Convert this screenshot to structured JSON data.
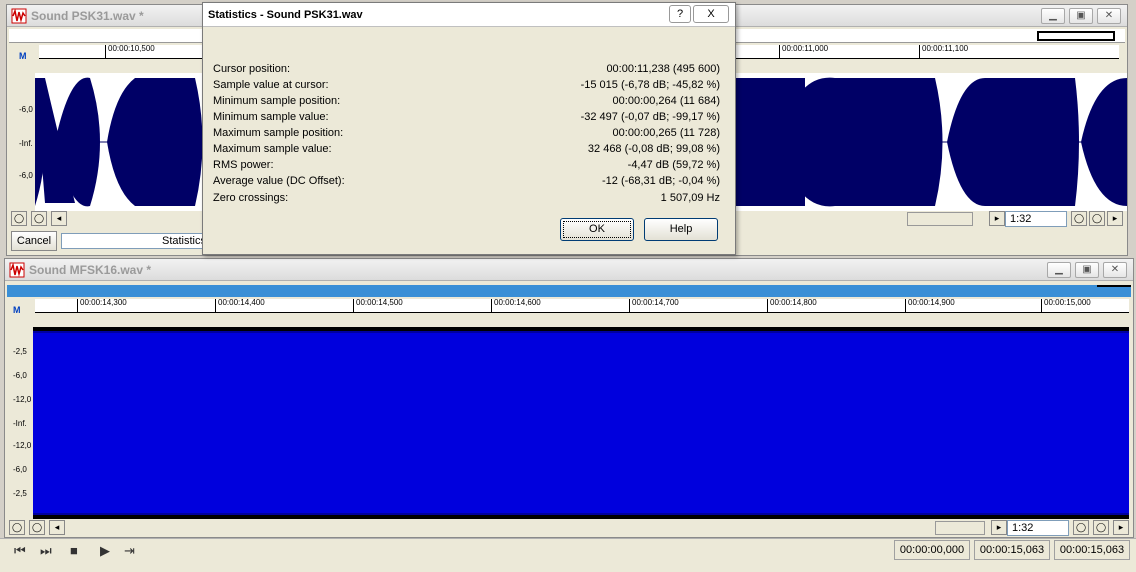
{
  "window1": {
    "title": "Sound PSK31.wav *",
    "ruler_ticks": [
      "00:00:10,500",
      "00:00:11,000",
      "00:00:11,100"
    ],
    "y_labels": [
      "-6,0",
      "-Inf.",
      "-6,0"
    ],
    "zoom_value": "1:32",
    "cancel_label": "Cancel",
    "status_text": "Statistics"
  },
  "window2": {
    "title": "Sound MFSK16.wav *",
    "ruler_ticks": [
      "00:00:14,300",
      "00:00:14,400",
      "00:00:14,500",
      "00:00:14,600",
      "00:00:14,700",
      "00:00:14,800",
      "00:00:14,900",
      "00:00:15,000"
    ],
    "y_labels": [
      "-2,5",
      "-6,0",
      "-12,0",
      "-Inf.",
      "-12,0",
      "-6,0",
      "-2,5"
    ],
    "zoom_value": "1:32"
  },
  "dialog": {
    "title": "Statistics - Sound PSK31.wav",
    "stats": [
      {
        "label": "Cursor position:",
        "value": "00:00:11,238  (495 600)"
      },
      {
        "label": "Sample value at cursor:",
        "value": "-15 015 (-6,78 dB; -45,82 %)"
      },
      {
        "label": "Minimum sample position:",
        "value": "00:00:00,264  (11 684)"
      },
      {
        "label": "Minimum sample value:",
        "value": "-32 497 (-0,07 dB; -99,17 %)"
      },
      {
        "label": "Maximum sample position:",
        "value": "00:00:00,265  (11 728)"
      },
      {
        "label": "Maximum sample value:",
        "value": "32 468 (-0,08 dB; 99,08 %)"
      },
      {
        "label": "RMS power:",
        "value": "-4,47 dB (59,72 %)"
      },
      {
        "label": "Average value (DC Offset):",
        "value": "-12 (-68,31 dB; -0,04 %)"
      },
      {
        "label": "Zero crossings:",
        "value": "1 507,09 Hz"
      }
    ],
    "ok_label": "OK",
    "help_label": "Help",
    "help_glyph": "?",
    "close_glyph": "X"
  },
  "statusbar": {
    "selection_start": "00:00:00,000",
    "selection_end": "00:00:15,063",
    "length": "00:00:15,063"
  },
  "colors": {
    "wave1": "#000066",
    "wave2": "#0000dd",
    "overview": "#3a8fd6"
  },
  "icons": [
    "wave-app-icon",
    "minimize-icon",
    "restore-icon",
    "close-icon",
    "zoom-in-icon",
    "zoom-out-icon",
    "scroll-left-icon",
    "scroll-right-icon",
    "go-start-icon",
    "go-end-icon",
    "stop-icon",
    "play-icon",
    "play-looped-icon"
  ]
}
